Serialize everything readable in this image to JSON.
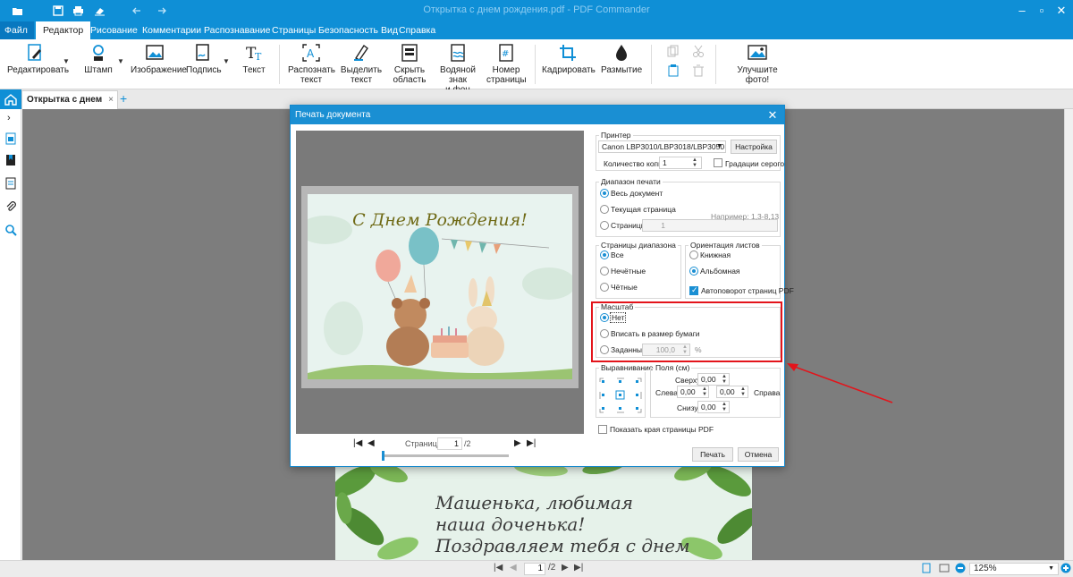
{
  "titlebar": {
    "title": "Открытка с днем рождения.pdf - PDF Commander",
    "icons": [
      "folder-icon",
      "save-icon",
      "print-icon",
      "eraser-icon",
      "undo-icon",
      "redo-icon"
    ]
  },
  "menu": {
    "file": "Файл ▾",
    "tabs": [
      "Редактор",
      "Рисование",
      "Комментарии",
      "Распознавание",
      "Страницы",
      "Безопасность",
      "Вид",
      "Справка"
    ]
  },
  "ribbon": {
    "edit": "Редактировать",
    "stamp": "Штамп",
    "image": "Изображение",
    "sign": "Подпись",
    "text": "Текст",
    "recognize_l1": "Распознать",
    "recognize_l2": "текст",
    "select_l1": "Выделить",
    "select_l2": "текст",
    "hide_l1": "Скрыть",
    "hide_l2": "область",
    "watermark_l1": "Водяной знак",
    "watermark_l2": "и фон",
    "pagenum_l1": "Номер",
    "pagenum_l2": "страницы",
    "crop": "Кадрировать",
    "blur": "Размытие",
    "enhance": "Улучшите фото!"
  },
  "doc_tab": {
    "label": "Открытка с днем рожд...",
    "close": "×"
  },
  "card_bottom": {
    "line1": "Машенька, любимая",
    "line2": "наша доченька!",
    "line3": "Поздравляем тебя с днем"
  },
  "statusbar": {
    "page": "1",
    "total": "/2",
    "zoom": "125%"
  },
  "dialog": {
    "title": "Печать документа",
    "preview_heading": "С Днем Рождения!",
    "preview_page_label": "Страница:",
    "preview_page": "1",
    "preview_total": "/2",
    "printer": {
      "group": "Принтер",
      "selected": "Canon LBP3010/LBP3018/LBP3050",
      "settings_btn": "Настройка",
      "copies_label": "Количество копий",
      "copies": "1",
      "grayscale": "Градации серого"
    },
    "range": {
      "group": "Диапазон печати",
      "all": "Весь документ",
      "current": "Текущая страница",
      "pages": "Страницы:",
      "pages_value": "1",
      "example": "Например: 1,3-8,13"
    },
    "subset": {
      "group": "Страницы диапазона",
      "all": "Все",
      "odd": "Нечётные",
      "even": "Чётные"
    },
    "orientation": {
      "group": "Ориентация листов",
      "portrait": "Книжная",
      "landscape": "Альбомная",
      "autorotate": "Автоповорот страниц PDF"
    },
    "scale": {
      "group": "Масштаб",
      "none": "Нет",
      "fit": "Вписать в размер бумаги",
      "custom": "Заданный:",
      "custom_value": "100,0",
      "percent": "%"
    },
    "align": {
      "group": "Выравнивание"
    },
    "margins": {
      "group": "Поля (см)",
      "top_label": "Сверху",
      "top": "0,00",
      "left_label": "Слева",
      "left": "0,00",
      "right_label": "Справа",
      "right": "0,00",
      "bottom_label": "Снизу",
      "bottom": "0,00"
    },
    "show_edges": "Показать края страницы PDF",
    "print_btn": "Печать",
    "cancel_btn": "Отмена"
  },
  "colors": {
    "accent": "#0f8fd6",
    "highlight": "#e3141b"
  }
}
